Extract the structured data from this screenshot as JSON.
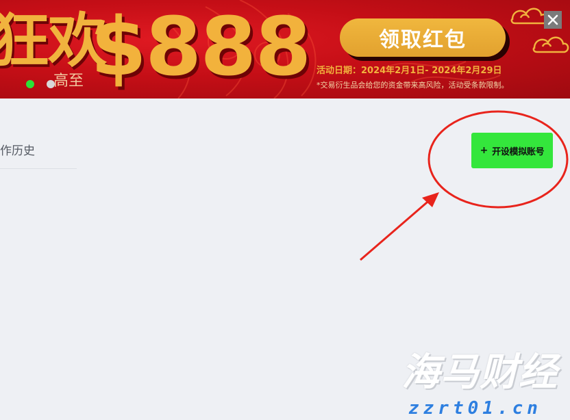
{
  "banner": {
    "headline": "狂欢",
    "amount": "$888",
    "prefix": "高至",
    "claim_label": "领取红包",
    "promo_date": "活动日期：2024年2月1日- 2024年2月29日",
    "disclaimer": "*交易衍生品会给您的资金带来高风险，活动受条款限制。",
    "close_label": "✕",
    "active_dot_color": "#2ae337",
    "inactive_dot_color": "#d8d8d8",
    "banner_color": "#c40e16",
    "gold_color": "#f1b33e"
  },
  "tabs": {
    "history_label": "作历史"
  },
  "actions": {
    "open_demo_plus": "+",
    "open_demo_label": "开设模拟账号",
    "open_demo_color": "#34e63c"
  },
  "annotation": {
    "color": "#e8241c",
    "shape": "ellipse-with-arrow"
  },
  "watermark": {
    "title": "海马财经",
    "url": "zzrt01.cn"
  }
}
